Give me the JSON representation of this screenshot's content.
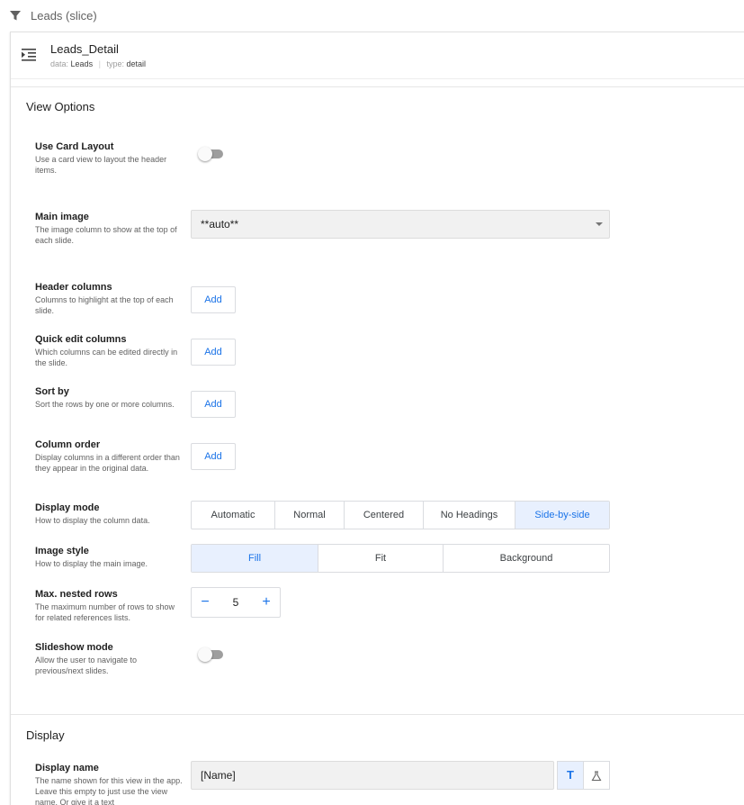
{
  "breadcrumb": {
    "title": "Leads (slice)",
    "icon": "filter-icon"
  },
  "view": {
    "name": "Leads_Detail",
    "data_label": "data:",
    "data_value": "Leads",
    "type_label": "type:",
    "type_value": "detail",
    "icon": "detail-view-icon"
  },
  "view_options": {
    "title": "View Options",
    "use_card_layout": {
      "label": "Use Card Layout",
      "desc": "Use a card view to layout the header items.",
      "enabled": false
    },
    "main_image": {
      "label": "Main image",
      "desc": "The image column to show at the top of each slide.",
      "value": "**auto**"
    },
    "header_columns": {
      "label": "Header columns",
      "desc": "Columns to highlight at the top of each slide.",
      "button": "Add"
    },
    "quick_edit_columns": {
      "label": "Quick edit columns",
      "desc": "Which columns can be edited directly in the slide.",
      "button": "Add"
    },
    "sort_by": {
      "label": "Sort by",
      "desc": "Sort the rows by one or more columns.",
      "button": "Add"
    },
    "column_order": {
      "label": "Column order",
      "desc": "Display columns in a different order than they appear in the original data.",
      "button": "Add"
    },
    "display_mode": {
      "label": "Display mode",
      "desc": "How to display the column data.",
      "options": [
        "Automatic",
        "Normal",
        "Centered",
        "No Headings",
        "Side-by-side"
      ],
      "selected": "Side-by-side"
    },
    "image_style": {
      "label": "Image style",
      "desc": "How to display the main image.",
      "options": [
        "Fill",
        "Fit",
        "Background"
      ],
      "selected": "Fill"
    },
    "max_nested_rows": {
      "label": "Max. nested rows",
      "desc": "The maximum number of rows to show for related references lists.",
      "value": "5",
      "minus": "−",
      "plus": "+"
    },
    "slideshow_mode": {
      "label": "Slideshow mode",
      "desc": "Allow the user to navigate to previous/next slides.",
      "enabled": false
    }
  },
  "display": {
    "title": "Display",
    "display_name": {
      "label": "Display name",
      "desc": "The name shown for this view in the app. Leave this empty to just use the view name. Or give it a text",
      "value": "[Name]",
      "text_mode": "T"
    }
  },
  "colors": {
    "accent": "#1a73e8",
    "selected_bg": "#e8f0fe",
    "input_bg": "#f1f1f1",
    "toggle_off": "#9e9e9e"
  }
}
